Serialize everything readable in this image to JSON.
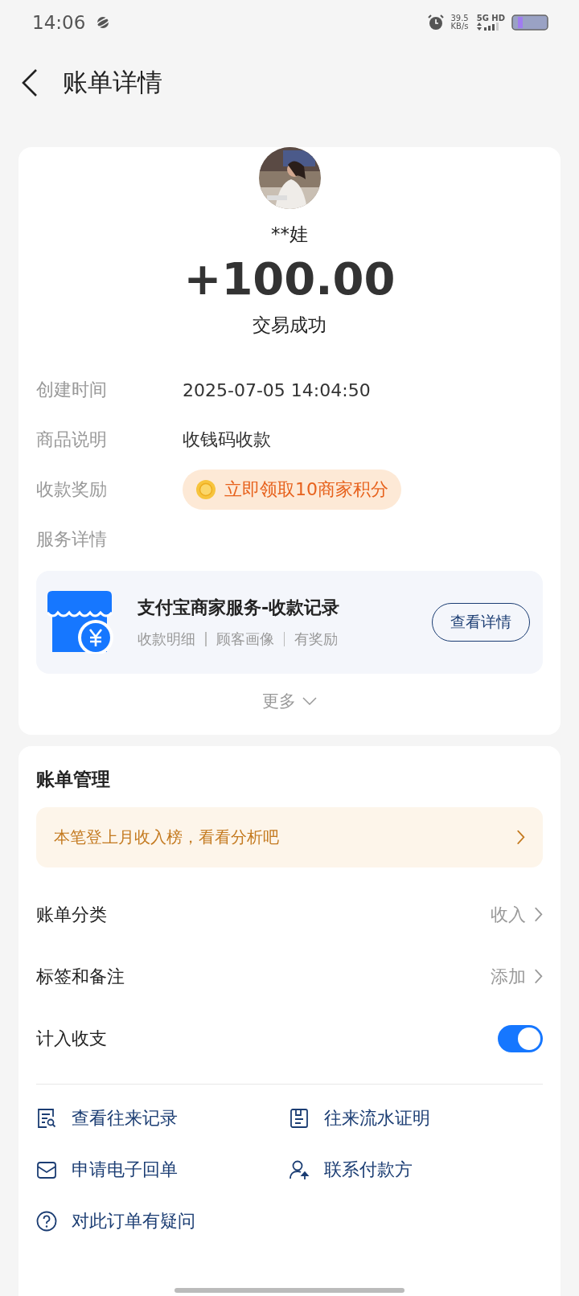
{
  "status_bar": {
    "time": "14:06",
    "speed": "39.5",
    "speed_unit": "KB/s",
    "network": "5G HD"
  },
  "header": {
    "title": "账单详情"
  },
  "summary": {
    "name": "**娃",
    "amount": "+100.00",
    "status": "交易成功",
    "details": [
      {
        "kind": "text",
        "label": "创建时间",
        "value": "2025-07-05 14:04:50"
      },
      {
        "kind": "text",
        "label": "商品说明",
        "value": "收钱码收款"
      },
      {
        "kind": "reward",
        "label": "收款奖励",
        "value": "立即领取10商家积分"
      },
      {
        "kind": "heading",
        "label": "服务详情"
      }
    ],
    "service": {
      "title": "支付宝商家服务-收款记录",
      "tags": [
        "收款明细",
        "顾客画像",
        "有奖励"
      ],
      "button": "查看详情"
    },
    "more": "更多"
  },
  "manage": {
    "title": "账单管理",
    "banner": "本笔登上月收入榜，看看分析吧",
    "settings": [
      {
        "kind": "link",
        "label": "账单分类",
        "value": "收入"
      },
      {
        "kind": "link",
        "label": "标签和备注",
        "value": "添加"
      },
      {
        "kind": "toggle",
        "label": "计入收支",
        "on": true
      }
    ],
    "actions": [
      {
        "kind": "records",
        "label": "查看往来记录"
      },
      {
        "kind": "statement",
        "label": "往来流水证明"
      },
      {
        "kind": "mail",
        "label": "申请电子回单"
      },
      {
        "kind": "contact",
        "label": "联系付款方"
      },
      {
        "kind": "question",
        "label": "对此订单有疑问"
      }
    ]
  }
}
